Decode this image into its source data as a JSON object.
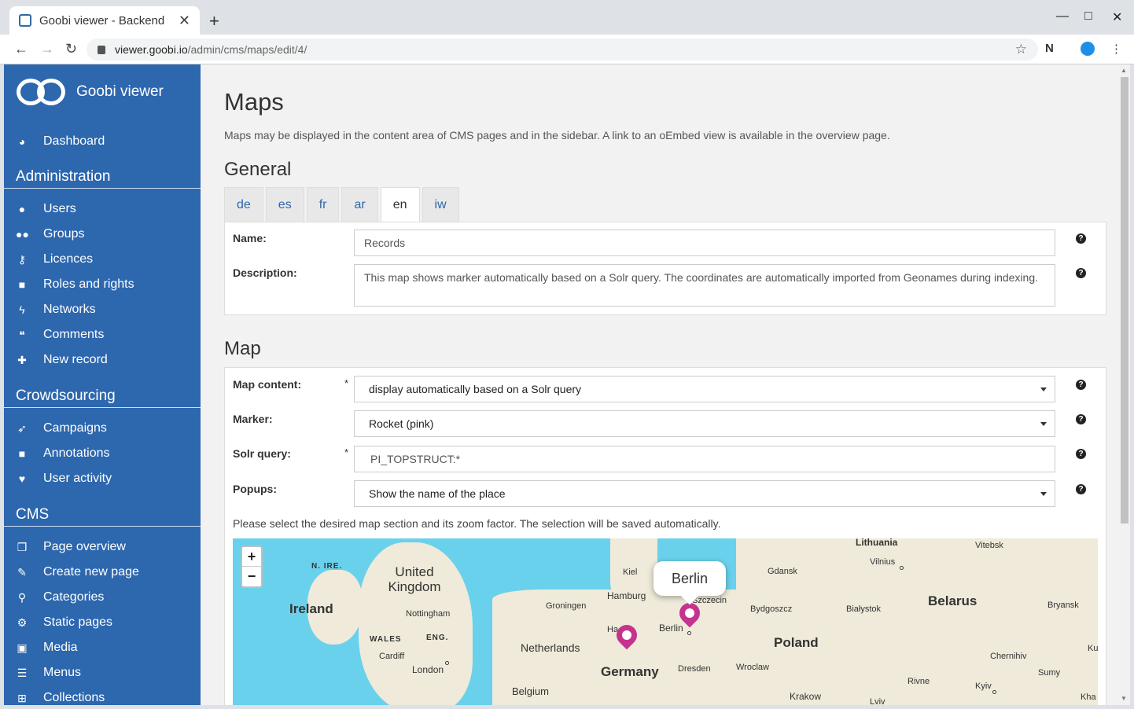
{
  "browser": {
    "tab_title": "Goobi viewer - Backend",
    "url_host": "viewer.goobi.io",
    "url_path": "/admin/cms/maps/edit/4/"
  },
  "sidebar": {
    "brand": "Goobi viewer",
    "dashboard": "Dashboard",
    "sections": {
      "administration": "Administration",
      "crowdsourcing": "Crowdsourcing",
      "cms": "CMS"
    },
    "admin_items": [
      "Users",
      "Groups",
      "Licences",
      "Roles and rights",
      "Networks",
      "Comments",
      "New record"
    ],
    "crowd_items": [
      "Campaigns",
      "Annotations",
      "User activity"
    ],
    "cms_items": [
      "Page overview",
      "Create new page",
      "Categories",
      "Static pages",
      "Media",
      "Menus",
      "Collections"
    ]
  },
  "page": {
    "title": "Maps",
    "intro": "Maps may be displayed in the content area of CMS pages and in the sidebar. A link to an oEmbed view is available in the overview page.",
    "general_heading": "General",
    "map_heading": "Map"
  },
  "languages": [
    "de",
    "es",
    "fr",
    "ar",
    "en",
    "iw"
  ],
  "active_language": "en",
  "general": {
    "name_label": "Name:",
    "name_value": "Records",
    "description_label": "Description:",
    "description_value": "This map shows marker automatically based on a Solr query. The coordinates are automatically imported from Geonames during indexing."
  },
  "map_form": {
    "content_label": "Map content:",
    "content_value": "display automatically based on a Solr query",
    "marker_label": "Marker:",
    "marker_value": "Rocket (pink)",
    "query_label": "Solr query:",
    "query_value": "PI_TOPSTRUCT:*",
    "popups_label": "Popups:",
    "popups_value": "Show the name of the place",
    "required_mark": "*",
    "help_glyph": "?",
    "hint": "Please select the desired map section and its zoom factor. The selection will be saved automatically."
  },
  "map": {
    "zoom_in": "+",
    "zoom_out": "−",
    "popup": "Berlin",
    "labels": {
      "lithuania": "Lithuania",
      "vitebsk": "Vitebsk",
      "vilnius": "Vilnius",
      "gdansk": "Gdansk",
      "kiel": "Kiel",
      "hamburg": "Hamburg",
      "szczecin": "Szczecin",
      "bydgoszcz": "Bydgoszcz",
      "bialystok": "Białystok",
      "belarus": "Belarus",
      "bryansk": "Bryansk",
      "n_ire": "N. IRE.",
      "united_kingdom": "United Kingdom",
      "ireland": "Ireland",
      "nottingham": "Nottingham",
      "groningen": "Groningen",
      "berlin": "Berlin",
      "poland": "Poland",
      "wales": "WALES",
      "eng": "ENG.",
      "cardiff": "Cardiff",
      "london": "London",
      "netherlands": "Netherlands",
      "germany": "Germany",
      "dresden": "Dresden",
      "wroclaw": "Wroclaw",
      "chernihiv": "Chernihiv",
      "sumy": "Sumy",
      "rivne": "Rivne",
      "kyiv": "Kyiv",
      "belgium": "Belgium",
      "krakow": "Krakow",
      "lviv": "Lviv",
      "kha": "Kha",
      "kur": "Kur",
      "ha": "Ha"
    }
  }
}
